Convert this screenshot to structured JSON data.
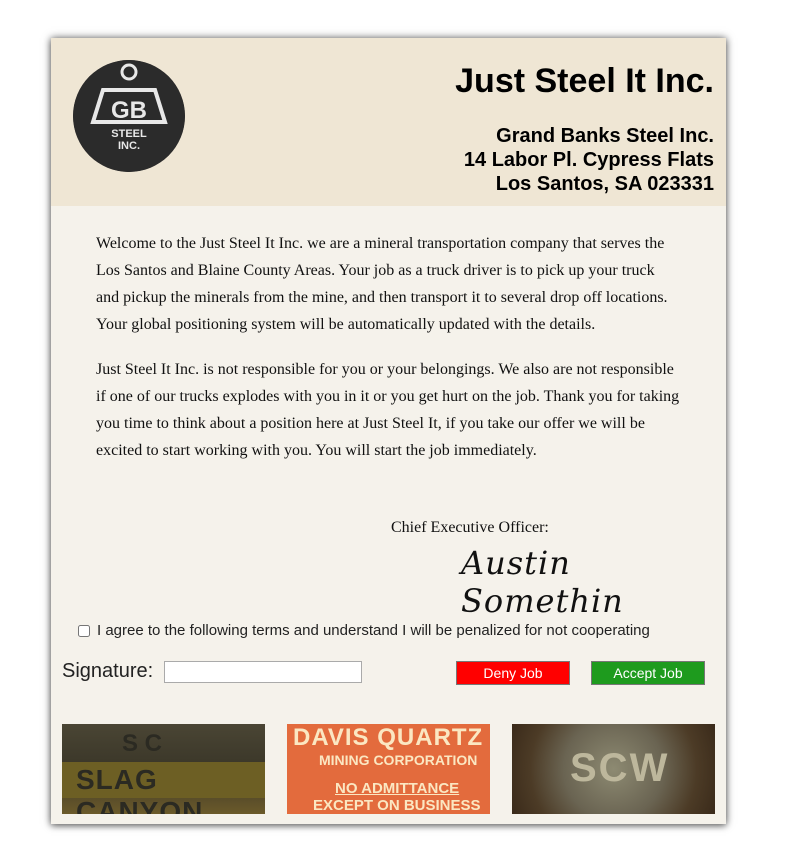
{
  "header": {
    "company_name": "Just Steel It Inc.",
    "address_lines": [
      "Grand Banks Steel Inc.",
      "14 Labor Pl. Cypress Flats",
      "Los Santos, SA 023331"
    ],
    "logo_text": "STEEL INC.",
    "logo_mark": "GB"
  },
  "letter": {
    "paragraph_1": "Welcome to the Just Steel It Inc. we are a mineral transportation company that serves the Los Santos and Blaine County Areas. Your job as a truck driver is to pick up your truck and pickup the minerals from the mine, and then transport it to several drop off locations. Your global positioning system will be automatically updated with the details.",
    "paragraph_2": "Just Steel It Inc. is not responsible for you or your belongings. We also are not responsible if one of our trucks explodes with you in it or you get hurt on the job. Thank you for taking you time to think about a position here at Just Steel It, if you take our offer we will be excited to start working with you. You will start the job immediately.",
    "ceo_title": "Chief Executive Officer:",
    "ceo_signature": "Austin Somethin"
  },
  "form": {
    "agree_label": "I agree to the following terms and understand I will be penalized for not cooperating",
    "agree_checked": false,
    "signature_label": "Signature:",
    "signature_value": "",
    "deny_label": "Deny Job",
    "accept_label": "Accept Job",
    "colors": {
      "deny": "#ff0000",
      "accept": "#1e9b1e"
    }
  },
  "photos": [
    {
      "name": "slag-canyon-sign",
      "text_top": "S C",
      "text_main": "SLAG CANYON"
    },
    {
      "name": "davis-quartz-sign",
      "text_main": "DAVIS QUARTZ",
      "text_sub": "MINING CORPORATION",
      "text_warning": "NO ADMITTANCE",
      "text_warning2": "EXCEPT ON BUSINESS"
    },
    {
      "name": "scw-sign",
      "text_main": "SCW"
    }
  ]
}
